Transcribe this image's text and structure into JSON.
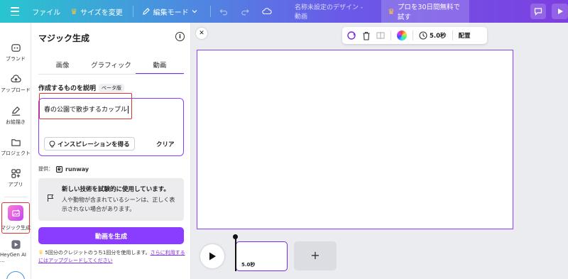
{
  "topbar": {
    "file": "ファイル",
    "resize": "サイズを変更",
    "edit_mode": "編集モード",
    "doc_title": "名称未設定のデザイン - 動画",
    "pro_trial": "プロを30日間無料で試す"
  },
  "rail": {
    "items": [
      {
        "label": "ブランド",
        "icon": "brand-icon"
      },
      {
        "label": "アップロード",
        "icon": "upload-icon"
      },
      {
        "label": "お絵描き",
        "icon": "draw-icon"
      },
      {
        "label": "プロジェクト",
        "icon": "folder-icon"
      },
      {
        "label": "アプリ",
        "icon": "apps-icon"
      },
      {
        "label": "マジック生成",
        "icon": "magic-media-icon"
      },
      {
        "label": "HeyGen AI ...",
        "icon": "heygen-icon"
      }
    ]
  },
  "panel": {
    "title": "マジック生成",
    "tabs": [
      "画像",
      "グラフィック",
      "動画"
    ],
    "active_tab": "動画",
    "desc_label": "作成するものを説明",
    "beta": "ベータ版",
    "prompt_value": "春の公園で散歩するカップル",
    "inspire": "インスピレーションを得る",
    "clear": "クリア",
    "provider_label": "提供：",
    "provider_name": "runway",
    "notice_title": "新しい技術を試験的に使用しています。",
    "notice_body": "人や動物が含まれているシーンは、正しく表示されない場合があります。",
    "generate": "動画を生成",
    "credit_text": "5回分のクレジットのうち1回分を使用します。",
    "credit_link": "さらに利用するにはアップグレードしてください"
  },
  "toolbar": {
    "duration": "5.0秒",
    "arrange": "配置"
  },
  "timeline": {
    "clip_duration": "5.0秒"
  },
  "colors": {
    "accent": "#8b3dff",
    "highlight": "#e1332d"
  }
}
